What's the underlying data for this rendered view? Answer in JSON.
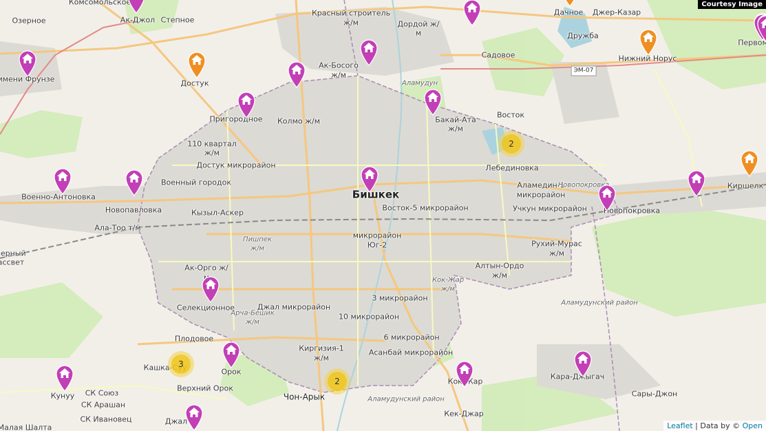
{
  "map": {
    "courtesy": "Courtesy Image",
    "attribution": {
      "leaflet": "Leaflet",
      "separator": " | Data by © ",
      "osm": "Open"
    },
    "colors": {
      "house_marker": "#c23fb6",
      "orange_marker": "#ef8f23",
      "cluster": "#f0c20c"
    },
    "labels": [
      {
        "text": "Комсомольское",
        "cls": ""
      },
      {
        "text": "Ак-Джол",
        "cls": ""
      },
      {
        "text": "Степное",
        "cls": ""
      },
      {
        "text": "Озерное",
        "cls": ""
      },
      {
        "text": "Красный строитель",
        "cls": ""
      },
      {
        "text": "ж/м",
        "cls": ""
      },
      {
        "text": "Дордой ж/",
        "cls": ""
      },
      {
        "text": "м",
        "cls": ""
      },
      {
        "text": "Дачное",
        "cls": ""
      },
      {
        "text": "Джер-Казар",
        "cls": ""
      },
      {
        "text": "Дружба",
        "cls": ""
      },
      {
        "text": "Первом",
        "cls": ""
      },
      {
        "text": "Садовое",
        "cls": ""
      },
      {
        "text": "Нижний Норус",
        "cls": ""
      },
      {
        "text": "Достук",
        "cls": ""
      },
      {
        "text": "имени Фрунзе",
        "cls": ""
      },
      {
        "text": "Ак-Босого",
        "cls": ""
      },
      {
        "text": "ж/м",
        "cls": ""
      },
      {
        "text": "Аламудун",
        "cls": "ital"
      },
      {
        "text": "ЭМ-07",
        "cls": "road"
      },
      {
        "text": "Пригородное",
        "cls": ""
      },
      {
        "text": "Колмо ж/м",
        "cls": ""
      },
      {
        "text": "Бакай-Ата",
        "cls": ""
      },
      {
        "text": "ж/м",
        "cls": ""
      },
      {
        "text": "Восток",
        "cls": ""
      },
      {
        "text": "110 квартал",
        "cls": ""
      },
      {
        "text": "ж/м",
        "cls": ""
      },
      {
        "text": "Достук микрорайон",
        "cls": ""
      },
      {
        "text": "Лебединовка",
        "cls": ""
      },
      {
        "text": "Военный городок",
        "cls": ""
      },
      {
        "text": "Бишкек",
        "cls": "city"
      },
      {
        "text": "Аламедин-1",
        "cls": ""
      },
      {
        "text": "микрорайон",
        "cls": ""
      },
      {
        "text": "Новопокровка",
        "cls": "ital"
      },
      {
        "text": "Киршелк",
        "cls": ""
      },
      {
        "text": "Военно-Антоновка",
        "cls": ""
      },
      {
        "text": "Новопавловка",
        "cls": ""
      },
      {
        "text": "Кызыл-Аскер",
        "cls": ""
      },
      {
        "text": "Восток-5 микрорайон",
        "cls": ""
      },
      {
        "text": "Учкун микрорайон",
        "cls": ""
      },
      {
        "text": "Новопокровка",
        "cls": ""
      },
      {
        "text": "Ала-Тоо т/м",
        "cls": ""
      },
      {
        "text": "микрорайон",
        "cls": ""
      },
      {
        "text": "Юг-2",
        "cls": ""
      },
      {
        "text": "Пишпек",
        "cls": "ital"
      },
      {
        "text": "ж/м",
        "cls": "ital"
      },
      {
        "text": "Рухий-Мурас",
        "cls": ""
      },
      {
        "text": "ж/м",
        "cls": ""
      },
      {
        "text": "верный",
        "cls": ""
      },
      {
        "text": "ассвет",
        "cls": ""
      },
      {
        "text": "Ак-Орго ж/",
        "cls": ""
      },
      {
        "text": "м",
        "cls": ""
      },
      {
        "text": "Алтын-Ордо",
        "cls": ""
      },
      {
        "text": "ж/м",
        "cls": ""
      },
      {
        "text": "Кок-Жар",
        "cls": "ital"
      },
      {
        "text": "ж/м",
        "cls": "ital"
      },
      {
        "text": "Аламудунский район",
        "cls": "ital"
      },
      {
        "text": "Селекционное",
        "cls": ""
      },
      {
        "text": "Джал микрорайон",
        "cls": ""
      },
      {
        "text": "3 микрорайон",
        "cls": ""
      },
      {
        "text": "Арча-Бешик",
        "cls": "ital"
      },
      {
        "text": "ж/м",
        "cls": "ital"
      },
      {
        "text": "10 микрорайон",
        "cls": ""
      },
      {
        "text": "Плодовое",
        "cls": ""
      },
      {
        "text": "6 микрорайон",
        "cls": ""
      },
      {
        "text": "Киргизия-1",
        "cls": ""
      },
      {
        "text": "ж/м",
        "cls": ""
      },
      {
        "text": "Асанбай микрорайон",
        "cls": ""
      },
      {
        "text": "Кашка-Суу",
        "cls": ""
      },
      {
        "text": "Орок",
        "cls": ""
      },
      {
        "text": "Кок-Жар",
        "cls": ""
      },
      {
        "text": "Кара-Джыгач",
        "cls": ""
      },
      {
        "text": "Кунуу",
        "cls": ""
      },
      {
        "text": "Верхний Орок",
        "cls": ""
      },
      {
        "text": "Сары-Джон",
        "cls": ""
      },
      {
        "text": "СК Союз",
        "cls": ""
      },
      {
        "text": "Чон-Арык",
        "cls": "town"
      },
      {
        "text": "Аламудунский район",
        "cls": "ital"
      },
      {
        "text": "СК Арашан",
        "cls": ""
      },
      {
        "text": "Кек-Джар",
        "cls": ""
      },
      {
        "text": "СК Ивановец",
        "cls": ""
      },
      {
        "text": "Джал",
        "cls": ""
      },
      {
        "text": "Малая Шалта",
        "cls": ""
      }
    ],
    "markers": [
      {
        "kind": "house",
        "color": "#c23fb6"
      },
      {
        "kind": "house",
        "color": "#c23fb6"
      },
      {
        "kind": "house",
        "color": "#c23fb6"
      },
      {
        "kind": "house",
        "color": "#c23fb6"
      },
      {
        "kind": "house",
        "color": "#c23fb6"
      },
      {
        "kind": "house",
        "color": "#c23fb6"
      },
      {
        "kind": "house",
        "color": "#c23fb6"
      },
      {
        "kind": "house",
        "color": "#c23fb6"
      },
      {
        "kind": "house",
        "color": "#c23fb6"
      },
      {
        "kind": "house",
        "color": "#c23fb6"
      },
      {
        "kind": "house",
        "color": "#c23fb6"
      },
      {
        "kind": "house",
        "color": "#c23fb6"
      },
      {
        "kind": "house",
        "color": "#c23fb6"
      },
      {
        "kind": "house",
        "color": "#c23fb6"
      },
      {
        "kind": "house",
        "color": "#c23fb6"
      },
      {
        "kind": "house",
        "color": "#c23fb6"
      },
      {
        "kind": "house",
        "color": "#c23fb6"
      },
      {
        "kind": "house",
        "color": "#c23fb6"
      },
      {
        "kind": "house",
        "color": "#c23fb6"
      },
      {
        "kind": "house",
        "color": "#c23fb6"
      },
      {
        "kind": "house",
        "color": "#c23fb6"
      },
      {
        "kind": "house",
        "color": "#c23fb6"
      },
      {
        "kind": "house",
        "color": "#ef8f23"
      },
      {
        "kind": "house",
        "color": "#ef8f23"
      },
      {
        "kind": "house",
        "color": "#ef8f23"
      },
      {
        "kind": "house",
        "color": "#ef8f23"
      }
    ],
    "clusters": [
      {
        "count": "2"
      },
      {
        "count": "3"
      },
      {
        "count": "2"
      }
    ]
  }
}
